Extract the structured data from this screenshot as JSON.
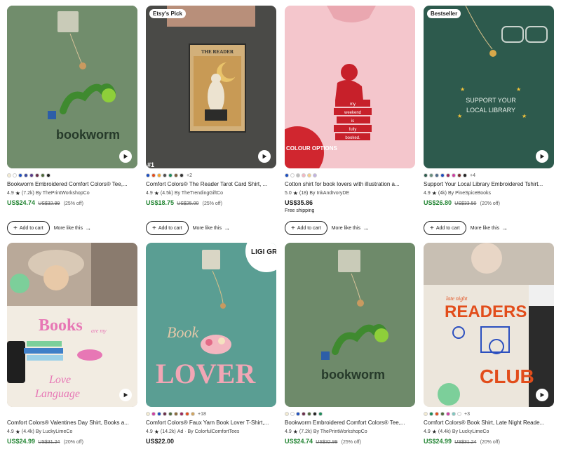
{
  "listings": [
    {
      "badge": "",
      "swatches": [
        "#f4ecd2",
        "#ffffff",
        "#1d4fbf",
        "#3a4aa0",
        "#5a3e8c",
        "#6a2e4a",
        "#4f6b3b",
        "#222222"
      ],
      "swatch_more": "",
      "title": "Bookworm Embroidered Comfort Colors® Tee,...",
      "rating": "4.9",
      "reviews": "(7.2k)",
      "shop": "By ThePrintWorkshopCo",
      "price": "US$24.74",
      "orig_price": "US$32.99",
      "discount": "(25% off)",
      "shipping": "",
      "art_label": "bookworm",
      "bg": "#6e8a6a"
    },
    {
      "badge": "Etsy's Pick",
      "swatches": [
        "#1d4fbf",
        "#e24d1b",
        "#f2a52b",
        "#4e4e4e",
        "#1d8a5a",
        "#7a5d3c",
        "#333333"
      ],
      "swatch_more": "+2",
      "title": "Comfort Colors® The Reader Tarot Card Shirt, ...",
      "rating": "4.9",
      "reviews": "(4.5k)",
      "shop": "By TheTrendingGiftCo",
      "price": "US$18.75",
      "orig_price": "US$25.00",
      "discount": "(25% off)",
      "shipping": "",
      "art_label": "THE READER",
      "corner_tag": "#1",
      "bg": "#4a4a47"
    },
    {
      "badge": "",
      "swatches": [
        "#1d4fbf",
        "#ffffff",
        "#bdbdbd",
        "#f4b6c2",
        "#f7d08a",
        "#c1b3df"
      ],
      "swatch_more": "",
      "title": "Cotton shirt for book lovers with illustration a...",
      "rating": "5.0",
      "reviews": "(18)",
      "shop": "By InkAndIvoryDE",
      "price": "US$35.86",
      "orig_price": "",
      "discount": "",
      "shipping": "Free shipping",
      "art_lines": [
        "my",
        "weekend",
        "is",
        "fully",
        "booked."
      ],
      "corner_tag": "COLOUR OPTIONS",
      "bg": "#f4c6cc"
    },
    {
      "badge": "Bestseller",
      "swatches": [
        "#2f5b4d",
        "#6a8f7e",
        "#4e6b8a",
        "#1d4fbf",
        "#9b2a5c",
        "#cf3fa3",
        "#7a2e2e",
        "#222222"
      ],
      "swatch_more": "+4",
      "title": "Support Your Local Library Embroidered Tshirt...",
      "rating": "4.9",
      "reviews": "(4k)",
      "shop": "By PineSpiceBooks",
      "price": "US$26.80",
      "orig_price": "US$33.50",
      "discount": "(20% off)",
      "shipping": "",
      "art_lines": [
        "SUPPORT YOUR",
        "LOCAL LIBRARY"
      ],
      "bg": "#2d5a4d"
    },
    {
      "badge": "",
      "swatches": [],
      "swatch_more": "",
      "title": "Comfort Colors® Valentines Day Shirt, Books a...",
      "rating": "4.9",
      "reviews": "(4.4k)",
      "shop": "By LuckyLimeCo",
      "price": "US$24.99",
      "orig_price": "US$31.24",
      "discount": "(20% off)",
      "shipping": "",
      "art_lines": [
        "Books",
        "are my",
        "Love",
        "Language"
      ],
      "bg": "#b9a999"
    },
    {
      "badge": "",
      "swatches": [
        "#f4ecd2",
        "#cf3fa3",
        "#1d4fbf",
        "#6a2e4a",
        "#4f6b3b",
        "#8a6a3a",
        "#9b2a5c",
        "#e24d1b",
        "#d0a45e"
      ],
      "swatch_more": "+18",
      "title": "Comfort Colors® Faux Yarn Book Lover T-Shirt,...",
      "rating": "4.9",
      "reviews": "(14.2k)",
      "shop": "Ad · By ColorfulComfortTees",
      "price": "US$22.00",
      "orig_price": "",
      "discount": "",
      "shipping": "",
      "art_lines": [
        "Book",
        "LOVER"
      ],
      "corner_tag": "LIGI GRE",
      "bg": "#5a9e93"
    },
    {
      "badge": "",
      "swatches": [
        "#f4ecd2",
        "#ffffff",
        "#1d4fbf",
        "#6a2e4a",
        "#4f6b3b",
        "#222222",
        "#1d8a5a"
      ],
      "swatch_more": "",
      "title": "Bookworm Embroidered Comfort Colors® Tee,...",
      "rating": "4.9",
      "reviews": "(7.2k)",
      "shop": "By ThePrintWorkshopCo",
      "price": "US$24.74",
      "orig_price": "US$32.99",
      "discount": "(25% off)",
      "shipping": "",
      "art_label": "bookworm",
      "bg": "#6e8a6a"
    },
    {
      "badge": "",
      "swatches": [
        "#f4ecd2",
        "#1d8a5a",
        "#e24d1b",
        "#4f6b3b",
        "#cf3fa3",
        "#7fc7c0",
        "#ffffff"
      ],
      "swatch_more": "+3",
      "title": "Comfort Colors® Book Shirt, Late Night Reade...",
      "rating": "4.9",
      "reviews": "(4.4k)",
      "shop": "By LuckyLimeCo",
      "price": "US$24.99",
      "orig_price": "US$31.24",
      "discount": "(20% off)",
      "shipping": "",
      "art_lines": [
        "late night",
        "READERS",
        "CLUB"
      ],
      "bg": "#ece6dc"
    }
  ],
  "labels": {
    "add_to_cart": "Add to cart",
    "more_like_this": "More like this"
  },
  "colors": {
    "sale_price": "#258635",
    "text": "#222222"
  }
}
